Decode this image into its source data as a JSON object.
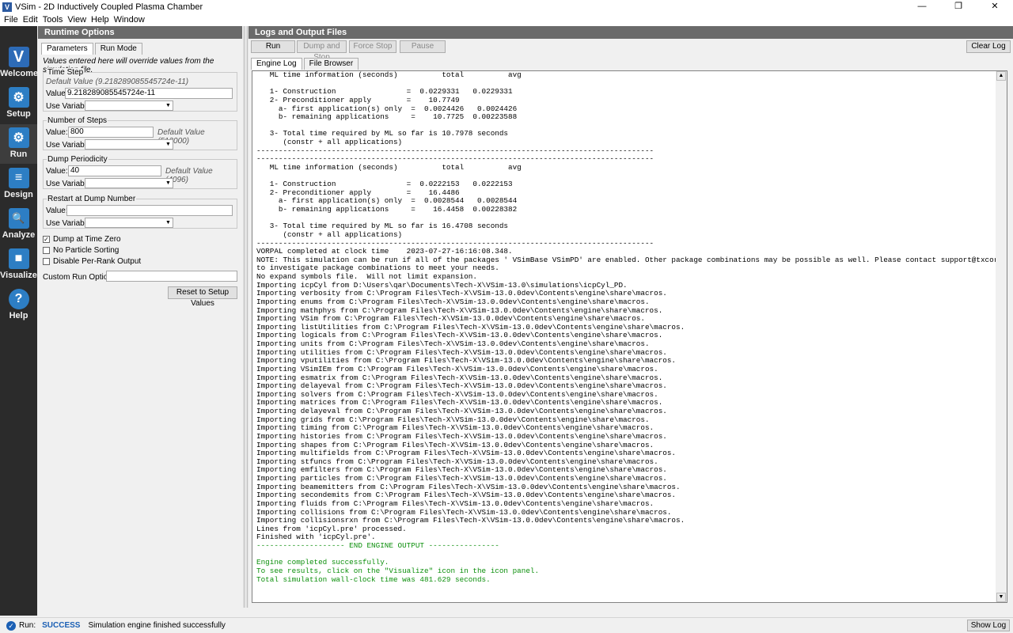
{
  "window": {
    "title": "VSim - 2D Inductively Coupled Plasma Chamber",
    "controls": [
      "—",
      "❐",
      "✕"
    ]
  },
  "menu": [
    "File",
    "Edit",
    "Tools",
    "View",
    "Help",
    "Window"
  ],
  "icon_panel": [
    {
      "label": "Welcome",
      "icon": "v-logo-icon",
      "glyph": "V",
      "color": "#2d6bb7"
    },
    {
      "label": "Setup",
      "icon": "gear-icon",
      "glyph": "⚙",
      "color": "#2d7ec4"
    },
    {
      "label": "Run",
      "icon": "gears-icon",
      "glyph": "⚙",
      "color": "#2d7ec4"
    },
    {
      "label": "Design",
      "icon": "design-icon",
      "glyph": "≡",
      "color": "#2d7ec4"
    },
    {
      "label": "Analyze",
      "icon": "magnifier-icon",
      "glyph": "🔍",
      "color": "#2d7ec4"
    },
    {
      "label": "Visualize",
      "icon": "cube-icon",
      "glyph": "■",
      "color": "#2d7ec4"
    },
    {
      "label": "Help",
      "icon": "help-icon",
      "glyph": "?",
      "color": "#2d7ec4"
    }
  ],
  "runtime": {
    "header": "Runtime Options",
    "tabs": [
      "Parameters",
      "Run Mode"
    ],
    "note": "Values entered here will override values from the simulation file.",
    "time_step": {
      "title": "Time Step",
      "default_label": "Default Value (9.218289085545724e-11)",
      "value_label": "Value:",
      "value": "9.218289085545724e-11",
      "use_variable_label": "Use Variable:"
    },
    "num_steps": {
      "title": "Number of Steps",
      "value_label": "Value:",
      "value": "800",
      "default_label": "Default Value (512000)",
      "use_variable_label": "Use Variable:"
    },
    "dump_periodicity": {
      "title": "Dump Periodicity",
      "value_label": "Value:",
      "value": "40",
      "default_label": "Default Value (4096)",
      "use_variable_label": "Use Variable:"
    },
    "restart": {
      "title": "Restart at Dump Number",
      "value_label": "Value:",
      "value": "",
      "use_variable_label": "Use Variable:"
    },
    "checks": [
      {
        "label": "Dump at Time Zero",
        "checked": true
      },
      {
        "label": "No Particle Sorting",
        "checked": false
      },
      {
        "label": "Disable Per-Rank Output",
        "checked": false
      }
    ],
    "custom_run_options_label": "Custom Run Options",
    "custom_run_options_value": "",
    "reset_button": "Reset to Setup Values"
  },
  "logs": {
    "header": "Logs and Output Files",
    "buttons": {
      "run": "Run",
      "dump_and_stop": "Dump and Stop",
      "force_stop": "Force Stop",
      "pause": "Pause",
      "clear_log": "Clear Log"
    },
    "tabs": [
      "Engine Log",
      "File Browser"
    ],
    "lines": [
      "   ML time information (seconds)          total          avg",
      "",
      "   1- Construction                =  0.0229331   0.0229331",
      "   2- Preconditioner apply        =    10.7749",
      "     a- first application(s) only  =  0.0024426   0.0024426",
      "     b- remaining applications     =    10.7725  0.00223588",
      "",
      "   3- Total time required by ML so far is 10.7978 seconds",
      "      (constr + all applications)",
      "------------------------------------------------------------------------------------------",
      "------------------------------------------------------------------------------------------",
      "   ML time information (seconds)          total          avg",
      "",
      "   1- Construction                =  0.0222153   0.0222153",
      "   2- Preconditioner apply        =    16.4486",
      "     a- first application(s) only  =  0.0028544   0.0028544",
      "     b- remaining applications     =    16.4458  0.00228382",
      "",
      "   3- Total time required by ML so far is 16.4708 seconds",
      "      (constr + all applications)",
      "------------------------------------------------------------------------------------------",
      "VORPAL completed at clock time    2023-07-27-16:16:08.348.",
      "NOTE: This simulation can be run if all of the packages ' VSimBase VSimPD' are enabled. Other package combinations may be possible as well. Please contact support@txcorp.com",
      "to investigate package combinations to meet your needs.",
      "No expand symbols file.  Will not limit expansion.",
      "Importing icpCyl from D:\\Users\\qar\\Documents\\Tech-X\\VSim-13.0\\simulations\\icpCyl_PD.",
      "Importing verbosity from C:\\Program Files\\Tech-X\\VSim-13.0.0dev\\Contents\\engine\\share\\macros.",
      "Importing enums from C:\\Program Files\\Tech-X\\VSim-13.0.0dev\\Contents\\engine\\share\\macros.",
      "Importing mathphys from C:\\Program Files\\Tech-X\\VSim-13.0.0dev\\Contents\\engine\\share\\macros.",
      "Importing VSim from C:\\Program Files\\Tech-X\\VSim-13.0.0dev\\Contents\\engine\\share\\macros.",
      "Importing listUtilities from C:\\Program Files\\Tech-X\\VSim-13.0.0dev\\Contents\\engine\\share\\macros.",
      "Importing logicals from C:\\Program Files\\Tech-X\\VSim-13.0.0dev\\Contents\\engine\\share\\macros.",
      "Importing units from C:\\Program Files\\Tech-X\\VSim-13.0.0dev\\Contents\\engine\\share\\macros.",
      "Importing utilities from C:\\Program Files\\Tech-X\\VSim-13.0.0dev\\Contents\\engine\\share\\macros.",
      "Importing vputilities from C:\\Program Files\\Tech-X\\VSim-13.0.0dev\\Contents\\engine\\share\\macros.",
      "Importing VSimIEm from C:\\Program Files\\Tech-X\\VSim-13.0.0dev\\Contents\\engine\\share\\macros.",
      "Importing esmatrix from C:\\Program Files\\Tech-X\\VSim-13.0.0dev\\Contents\\engine\\share\\macros.",
      "Importing delayeval from C:\\Program Files\\Tech-X\\VSim-13.0.0dev\\Contents\\engine\\share\\macros.",
      "Importing solvers from C:\\Program Files\\Tech-X\\VSim-13.0.0dev\\Contents\\engine\\share\\macros.",
      "Importing matrices from C:\\Program Files\\Tech-X\\VSim-13.0.0dev\\Contents\\engine\\share\\macros.",
      "Importing delayeval from C:\\Program Files\\Tech-X\\VSim-13.0.0dev\\Contents\\engine\\share\\macros.",
      "Importing grids from C:\\Program Files\\Tech-X\\VSim-13.0.0dev\\Contents\\engine\\share\\macros.",
      "Importing timing from C:\\Program Files\\Tech-X\\VSim-13.0.0dev\\Contents\\engine\\share\\macros.",
      "Importing histories from C:\\Program Files\\Tech-X\\VSim-13.0.0dev\\Contents\\engine\\share\\macros.",
      "Importing shapes from C:\\Program Files\\Tech-X\\VSim-13.0.0dev\\Contents\\engine\\share\\macros.",
      "Importing multifields from C:\\Program Files\\Tech-X\\VSim-13.0.0dev\\Contents\\engine\\share\\macros.",
      "Importing stfuncs from C:\\Program Files\\Tech-X\\VSim-13.0.0dev\\Contents\\engine\\share\\macros.",
      "Importing emfilters from C:\\Program Files\\Tech-X\\VSim-13.0.0dev\\Contents\\engine\\share\\macros.",
      "Importing particles from C:\\Program Files\\Tech-X\\VSim-13.0.0dev\\Contents\\engine\\share\\macros.",
      "Importing beamemitters from C:\\Program Files\\Tech-X\\VSim-13.0.0dev\\Contents\\engine\\share\\macros.",
      "Importing secondemits from C:\\Program Files\\Tech-X\\VSim-13.0.0dev\\Contents\\engine\\share\\macros.",
      "Importing fluids from C:\\Program Files\\Tech-X\\VSim-13.0.0dev\\Contents\\engine\\share\\macros.",
      "Importing collisions from C:\\Program Files\\Tech-X\\VSim-13.0.0dev\\Contents\\engine\\share\\macros.",
      "Importing collisionsrxn from C:\\Program Files\\Tech-X\\VSim-13.0.0dev\\Contents\\engine\\share\\macros.",
      "Lines from 'icpCyl.pre' processed.",
      "Finished with 'icpCyl.pre'.",
      "-------------------- END ENGINE OUTPUT ----------------",
      "",
      "Engine completed successfully.",
      "To see results, click on the \"Visualize\" icon in the icon panel.",
      "Total simulation wall-clock time was 481.629 seconds."
    ],
    "green_from": 56
  },
  "status": {
    "label": "Run:",
    "state": "SUCCESS",
    "message": "Simulation engine finished successfully",
    "show_log": "Show Log"
  }
}
